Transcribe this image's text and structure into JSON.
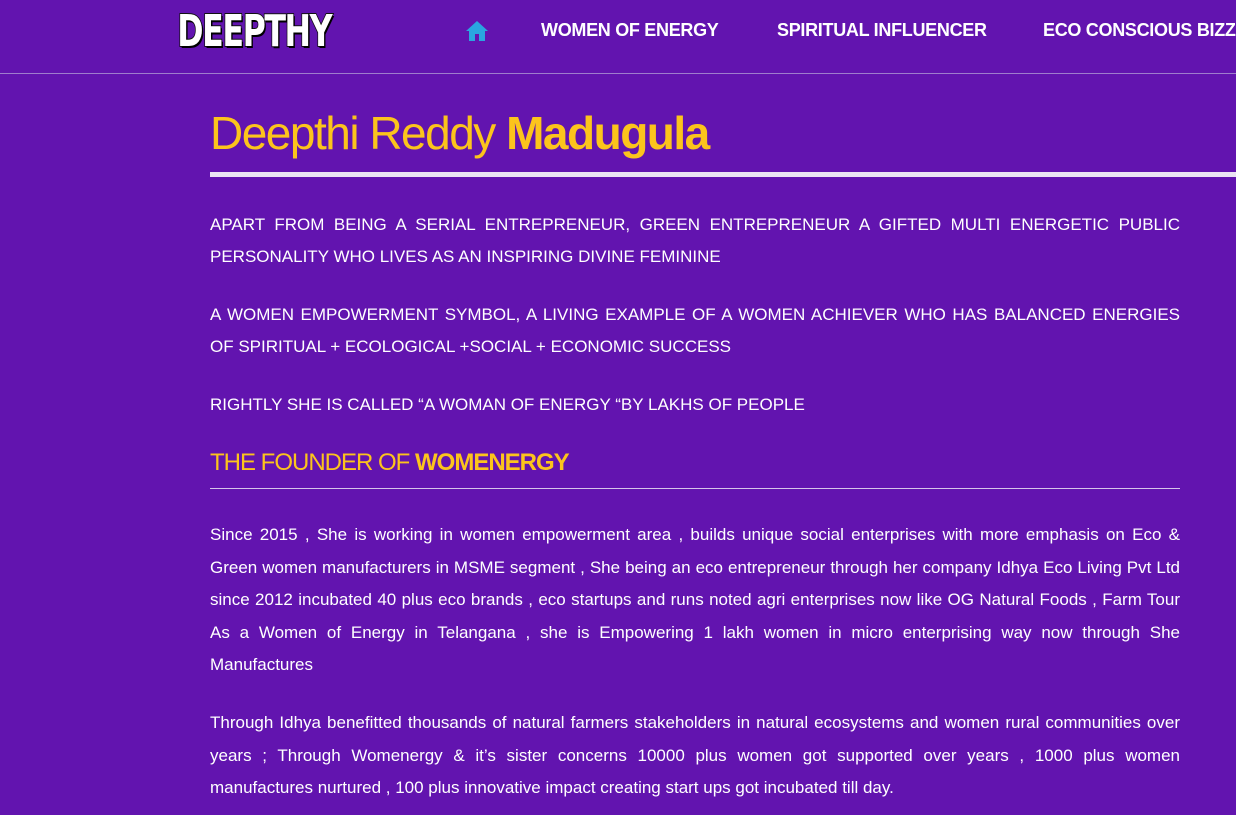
{
  "header": {
    "logo_text": "DEEPTHY",
    "home_icon": "home-icon",
    "nav": [
      {
        "label": "WOMEN OF ENERGY"
      },
      {
        "label": "SPIRITUAL INFLUENCER"
      },
      {
        "label": "ECO CONSCIOUS BIZZ"
      }
    ]
  },
  "main": {
    "title_regular": "Deepthi Reddy ",
    "title_bold": "Madugula",
    "paragraphs": [
      "APART FROM BEING A SERIAL ENTREPRENEUR, GREEN ENTREPRENEUR A GIFTED MULTI ENERGETIC PUBLIC PERSONALITY WHO LIVES AS AN INSPIRING DIVINE FEMININE",
      "A WOMEN EMPOWERMENT SYMBOL, A LIVING EXAMPLE OF A WOMEN ACHIEVER WHO HAS BALANCED ENERGIES OF SPIRITUAL + ECOLOGICAL +SOCIAL + ECONOMIC SUCCESS",
      "RIGHTLY SHE IS CALLED “A WOMAN OF ENERGY “BY LAKHS OF PEOPLE"
    ],
    "section_title_regular": "THE FOUNDER OF ",
    "section_title_bold": "WOMENERGY",
    "section_paragraphs": [
      "Since 2015 , She is working in women empowerment area , builds unique social enterprises with more emphasis on Eco & Green women manufacturers in MSME segment , She being an eco entrepreneur through her company Idhya Eco Living Pvt Ltd since 2012 incubated 40 plus eco brands , eco startups and runs noted agri enterprises now like OG Natural Foods , Farm Tour As a Women of Energy in Telangana , she is Empowering 1 lakh women in micro enterprising way now through She Manufactures",
      "Through Idhya benefitted thousands of natural farmers stakeholders in natural ecosystems and women rural communities over years ; Through Womenergy & it’s sister concerns 10000 plus women got supported over years , 1000 plus women manufactures nurtured , 100 plus innovative impact creating start ups got incubated till day."
    ]
  },
  "colors": {
    "background": "#6214af",
    "accent": "#fcc41c",
    "home_icon": "#2aa5e0",
    "text": "#ffffff"
  }
}
